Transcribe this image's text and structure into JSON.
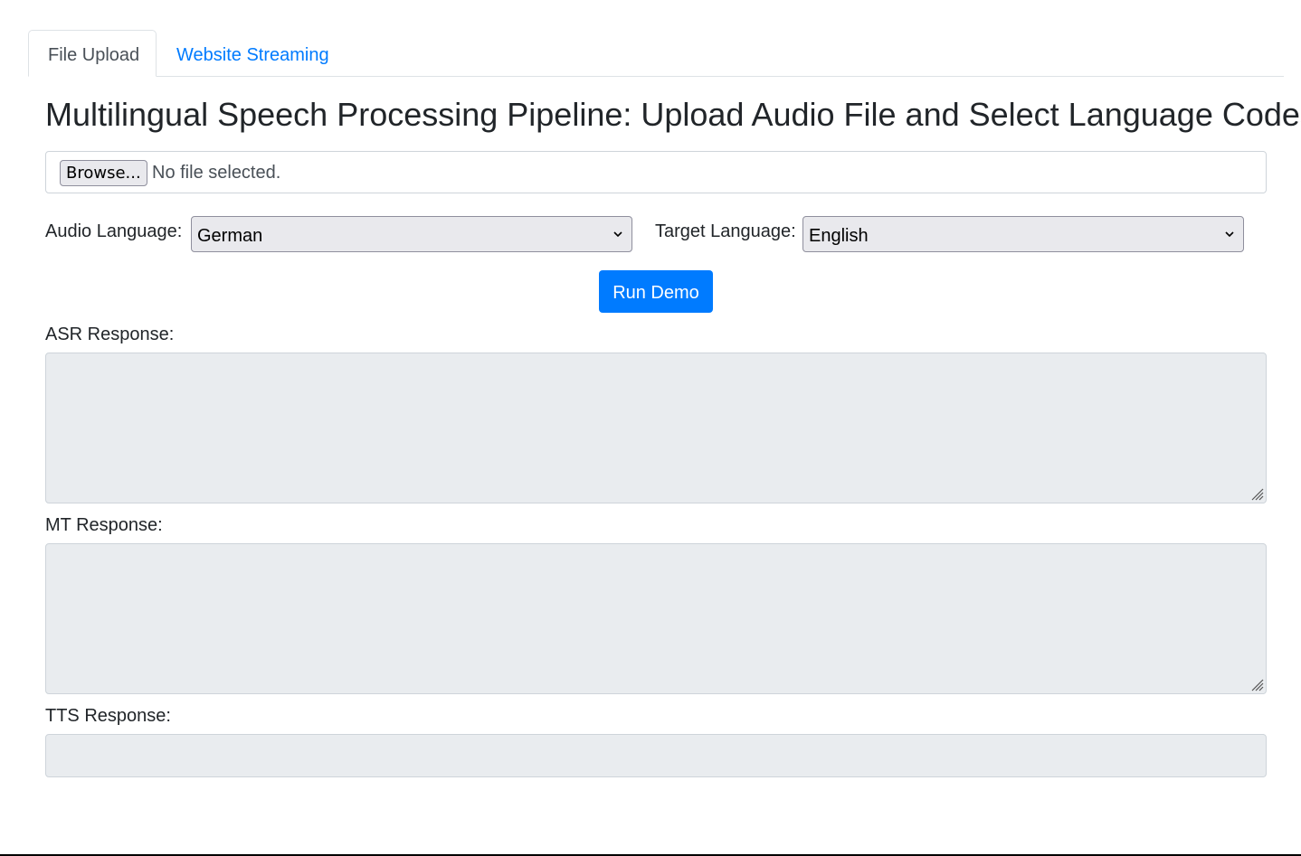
{
  "tabs": [
    {
      "label": "File Upload",
      "active": true
    },
    {
      "label": "Website Streaming",
      "active": false
    }
  ],
  "title": "Multilingual Speech Processing Pipeline: Upload Audio File and Select Language Codes",
  "file_input": {
    "button_label": "Browse...",
    "status": "No file selected."
  },
  "audio_language": {
    "label": "Audio Language:",
    "selected": "German"
  },
  "target_language": {
    "label": "Target Language:",
    "selected": "English"
  },
  "run_button": {
    "label": "Run Demo"
  },
  "responses": {
    "asr": {
      "label": "ASR Response:",
      "value": ""
    },
    "mt": {
      "label": "MT Response:",
      "value": ""
    },
    "tts": {
      "label": "TTS Response:",
      "value": ""
    }
  },
  "colors": {
    "accent": "#007bff",
    "readonly_bg": "#e9ecef",
    "border": "#ced4da"
  },
  "icons": {
    "select_chevron": "chevron-down-icon",
    "textarea_grip": "resize-grip-icon"
  }
}
